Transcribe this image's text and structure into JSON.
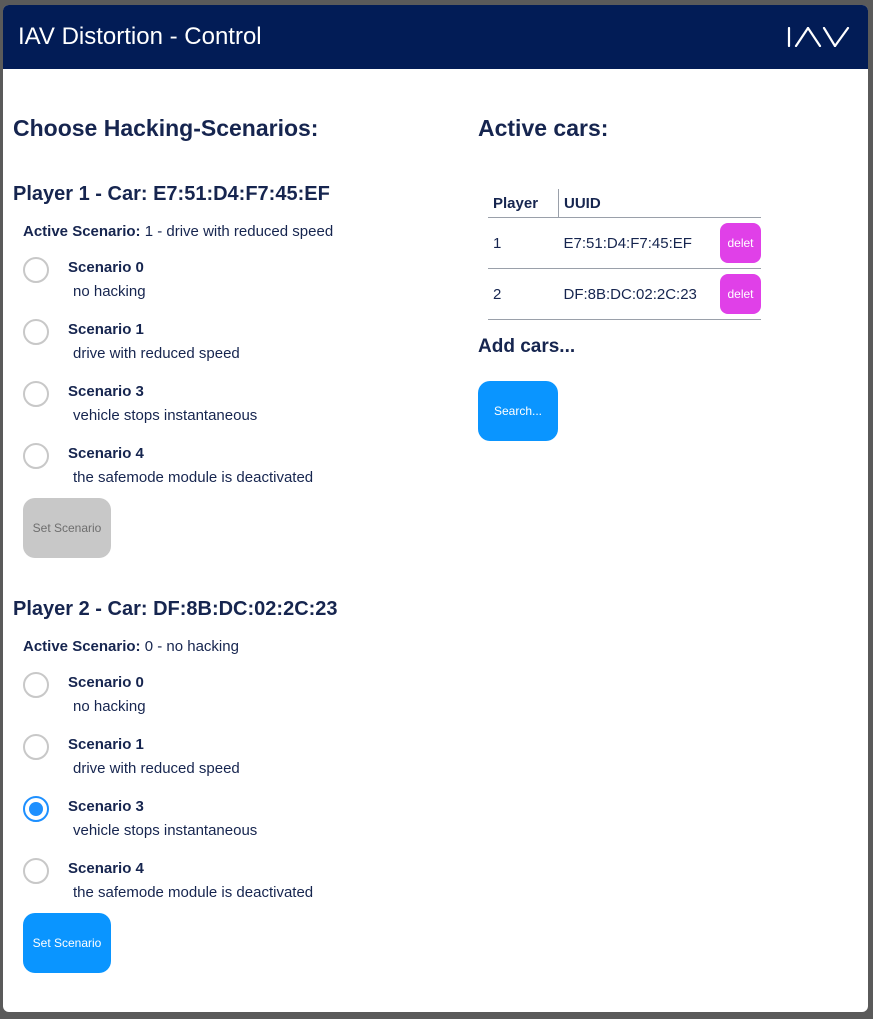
{
  "window": {
    "title": "IAV Distortion - Control"
  },
  "left": {
    "heading": "Choose Hacking-Scenarios:",
    "players": [
      {
        "title": "Player 1 - Car: E7:51:D4:F7:45:EF",
        "active_label": "Active Scenario:",
        "active_value": "1 - drive with reduced speed",
        "scenarios": [
          {
            "name": "Scenario 0",
            "description": "no hacking",
            "selected": false
          },
          {
            "name": "Scenario 1",
            "description": "drive with reduced speed",
            "selected": false
          },
          {
            "name": "Scenario 3",
            "description": "vehicle stops instantaneous",
            "selected": false
          },
          {
            "name": "Scenario 4",
            "description": "the safemode module is deactivated",
            "selected": false
          }
        ],
        "button_label": "Set Scenario",
        "button_enabled": false
      },
      {
        "title": "Player 2 - Car: DF:8B:DC:02:2C:23",
        "active_label": "Active Scenario:",
        "active_value": "0 - no hacking",
        "scenarios": [
          {
            "name": "Scenario 0",
            "description": "no hacking",
            "selected": false
          },
          {
            "name": "Scenario 1",
            "description": "drive with reduced speed",
            "selected": false
          },
          {
            "name": "Scenario 3",
            "description": "vehicle stops instantaneous",
            "selected": true
          },
          {
            "name": "Scenario 4",
            "description": "the safemode module is deactivated",
            "selected": false
          }
        ],
        "button_label": "Set Scenario",
        "button_enabled": true
      }
    ]
  },
  "right": {
    "heading": "Active cars:",
    "table": {
      "headers": [
        "Player",
        "UUID"
      ],
      "rows": [
        {
          "player": "1",
          "uuid": "E7:51:D4:F7:45:EF",
          "action": "delet"
        },
        {
          "player": "2",
          "uuid": "DF:8B:DC:02:2C:23",
          "action": "delet"
        }
      ]
    },
    "add_heading": "Add cars...",
    "search_label": "Search..."
  },
  "colors": {
    "header_bg": "#021c56",
    "text": "#16254f",
    "accent_blue": "#0a95ff",
    "delete_magenta": "#e040e8",
    "disabled_gray": "#c8c8c8"
  },
  "icons": {
    "logo": "iav-logo"
  }
}
